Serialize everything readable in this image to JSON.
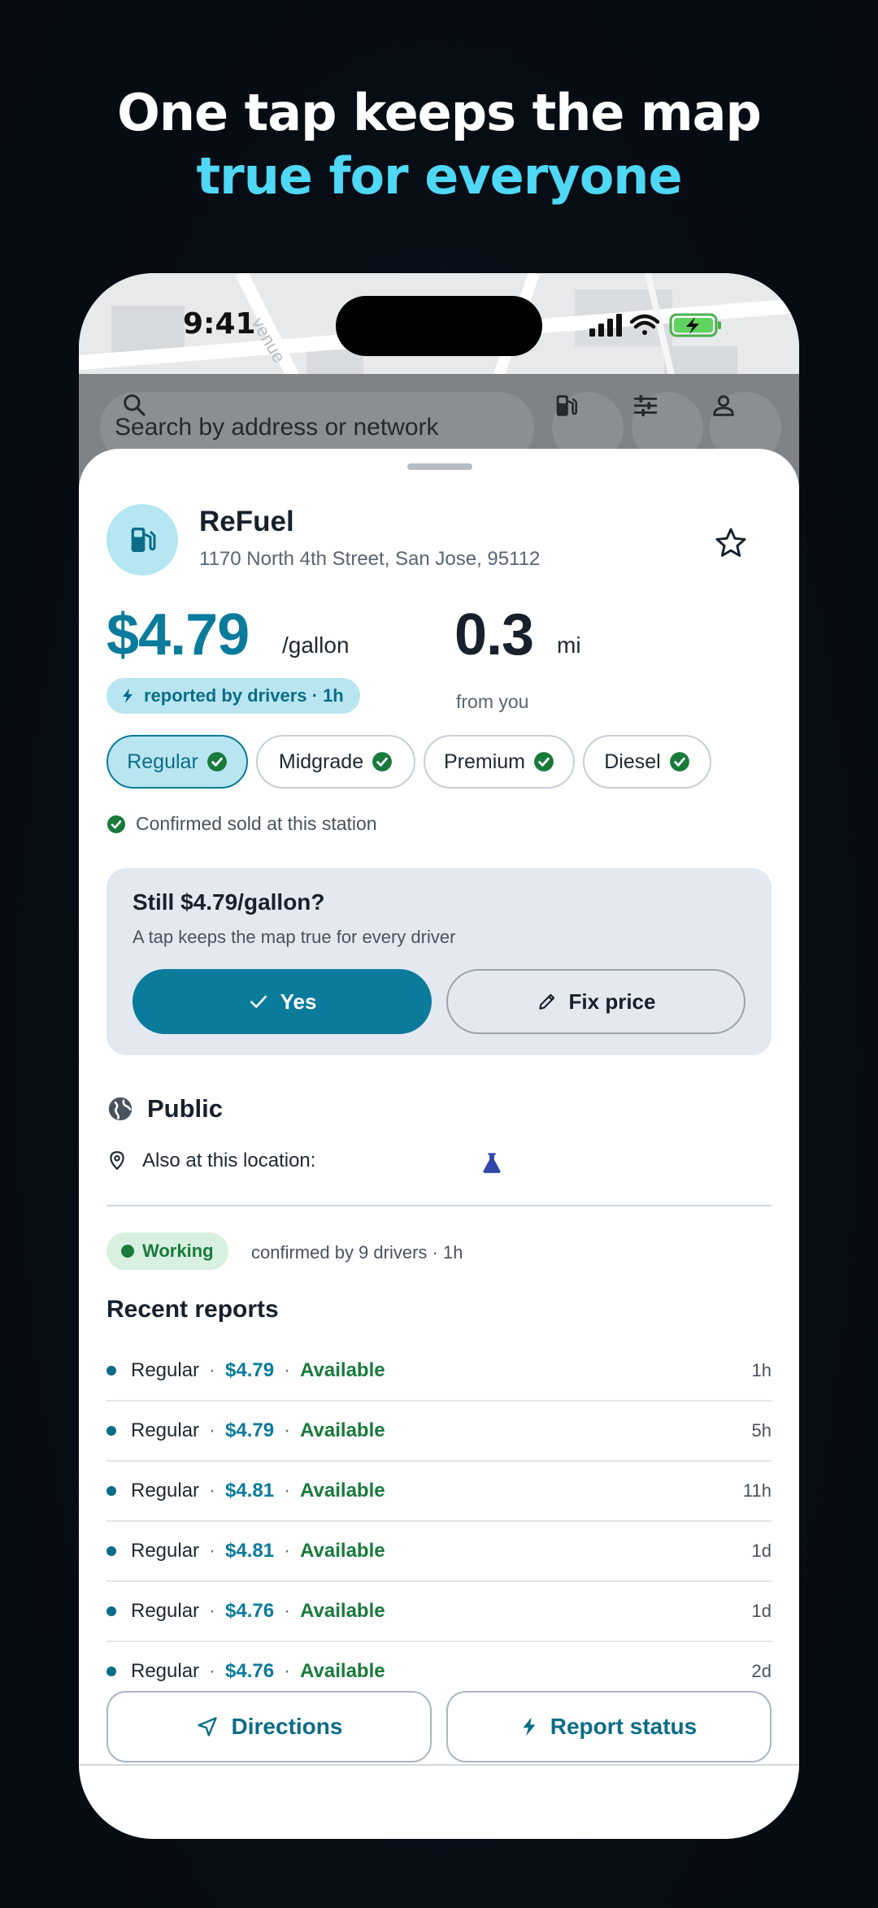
{
  "headline": {
    "line1": "One tap keeps the map",
    "line2": "true for everyone"
  },
  "status_bar": {
    "time": "9:41"
  },
  "map_label": "venue",
  "search": {
    "placeholder": "Search by address or network"
  },
  "icons": {
    "search": "search-icon",
    "fuel": "fuel-pump-icon",
    "filters": "sliders-icon",
    "account": "person-icon",
    "favorite": "star-icon",
    "bolt": "bolt-icon",
    "check": "check-circle-icon",
    "globe": "globe-icon",
    "pin": "location-pin-icon",
    "flask": "flask-icon",
    "navigate": "navigation-arrow-icon",
    "pencil": "pencil-icon"
  },
  "station": {
    "name": "ReFuel",
    "address": "1170 North 4th Street, San Jose, 95112",
    "price": "$4.79",
    "price_unit": "/gallon",
    "distance": "0.3",
    "distance_unit": "mi",
    "distance_caption": "from you",
    "reported": "reported by drivers · 1h"
  },
  "fuel_types": [
    {
      "label": "Regular",
      "selected": true
    },
    {
      "label": "Midgrade",
      "selected": false
    },
    {
      "label": "Premium",
      "selected": false
    },
    {
      "label": "Diesel",
      "selected": false
    }
  ],
  "confirmed_text": "Confirmed sold at this station",
  "confirm_card": {
    "title": "Still $4.79/gallon?",
    "subtitle": "A tap keeps the map true for every driver",
    "yes_label": "Yes",
    "fix_label": "Fix price"
  },
  "access": "Public",
  "also_at": "Also at this location:",
  "status": {
    "badge": "Working",
    "meta": "confirmed by 9 drivers · 1h"
  },
  "recent_title": "Recent reports",
  "reports": [
    {
      "type": "Regular",
      "price": "$4.79",
      "status": "Available",
      "age": "1h"
    },
    {
      "type": "Regular",
      "price": "$4.79",
      "status": "Available",
      "age": "5h"
    },
    {
      "type": "Regular",
      "price": "$4.81",
      "status": "Available",
      "age": "11h"
    },
    {
      "type": "Regular",
      "price": "$4.81",
      "status": "Available",
      "age": "1d"
    },
    {
      "type": "Regular",
      "price": "$4.76",
      "status": "Available",
      "age": "1d"
    },
    {
      "type": "Regular",
      "price": "$4.76",
      "status": "Available",
      "age": "2d"
    }
  ],
  "separator": "·",
  "actions": {
    "directions": "Directions",
    "report": "Report status"
  },
  "colors": {
    "accent": "#0b7b9c",
    "headline_accent": "#4fd8f5",
    "available": "#187a3b",
    "background": "#070d15"
  }
}
